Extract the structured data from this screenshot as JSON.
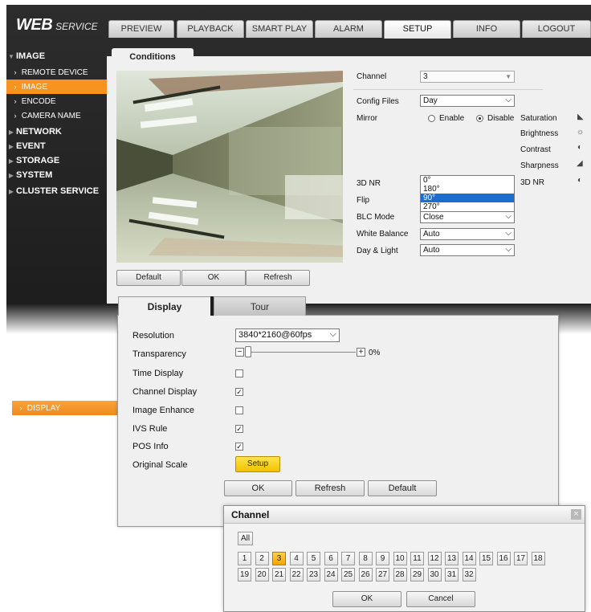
{
  "app": {
    "logo_main": "WEB",
    "logo_sub": "SERVICE"
  },
  "nav": {
    "tabs": [
      "PREVIEW",
      "PLAYBACK",
      "SMART PLAY",
      "ALARM",
      "SETUP",
      "INFO",
      "LOGOUT"
    ],
    "active_index": 4
  },
  "sidebar": {
    "image_header": "IMAGE",
    "sub_items": [
      "REMOTE DEVICE",
      "IMAGE",
      "ENCODE",
      "CAMERA NAME"
    ],
    "active_sub_index": 1,
    "sections": [
      "NETWORK",
      "EVENT",
      "STORAGE",
      "SYSTEM",
      "CLUSTER SERVICE"
    ]
  },
  "conditions": {
    "tab_label": "Conditions",
    "channel_label": "Channel",
    "channel_value": "3",
    "config_files_label": "Config Files",
    "config_files_value": "Day",
    "mirror_label": "Mirror",
    "mirror_enable": "Enable",
    "mirror_disable": "Disable",
    "right_labels": [
      "Saturation",
      "Brightness",
      "Contrast",
      "Sharpness",
      "3D NR"
    ],
    "nr_label": "3D NR",
    "flip_label": "Flip",
    "flip_options": [
      "0°",
      "180°",
      "90°",
      "270°"
    ],
    "flip_highlight": 2,
    "blc_label": "BLC Mode",
    "blc_value": "Close",
    "white_balance_label": "White Balance",
    "white_balance_value": "Auto",
    "day_light_label": "Day & Light",
    "day_light_value": "Auto",
    "buttons": {
      "default": "Default",
      "ok": "OK",
      "refresh": "Refresh"
    }
  },
  "display": {
    "tabs": [
      "Display",
      "Tour"
    ],
    "sidebar_label": "DISPLAY",
    "resolution_label": "Resolution",
    "resolution_value": "3840*2160@60fps",
    "transparency_label": "Transparency",
    "transparency_value": "0%",
    "transparency_fraction": 0,
    "minus_symbol": "−",
    "plus_symbol": "+",
    "options": [
      {
        "label": "Time Display",
        "checked": false
      },
      {
        "label": "Channel Display",
        "checked": true
      },
      {
        "label": "Image Enhance",
        "checked": false
      },
      {
        "label": "IVS Rule",
        "checked": true
      },
      {
        "label": "POS Info",
        "checked": true
      }
    ],
    "original_scale_label": "Original Scale",
    "setup_button": "Setup",
    "buttons": {
      "ok": "OK",
      "refresh": "Refresh",
      "default": "Default"
    }
  },
  "channel_dialog": {
    "title": "Channel",
    "close_symbol": "×",
    "all_label": "All",
    "channels": [
      "1",
      "2",
      "3",
      "4",
      "5",
      "6",
      "7",
      "8",
      "9",
      "10",
      "11",
      "12",
      "13",
      "14",
      "15",
      "16",
      "17",
      "18",
      "19",
      "20",
      "21",
      "22",
      "23",
      "24",
      "25",
      "26",
      "27",
      "28",
      "29",
      "30",
      "31",
      "32"
    ],
    "selected": "3",
    "ok": "OK",
    "cancel": "Cancel"
  },
  "colors": {
    "accent": "#f7931e",
    "dark_bg": "#222222",
    "highlight": "#1d6dd0",
    "setup_button": "#f5c600"
  }
}
